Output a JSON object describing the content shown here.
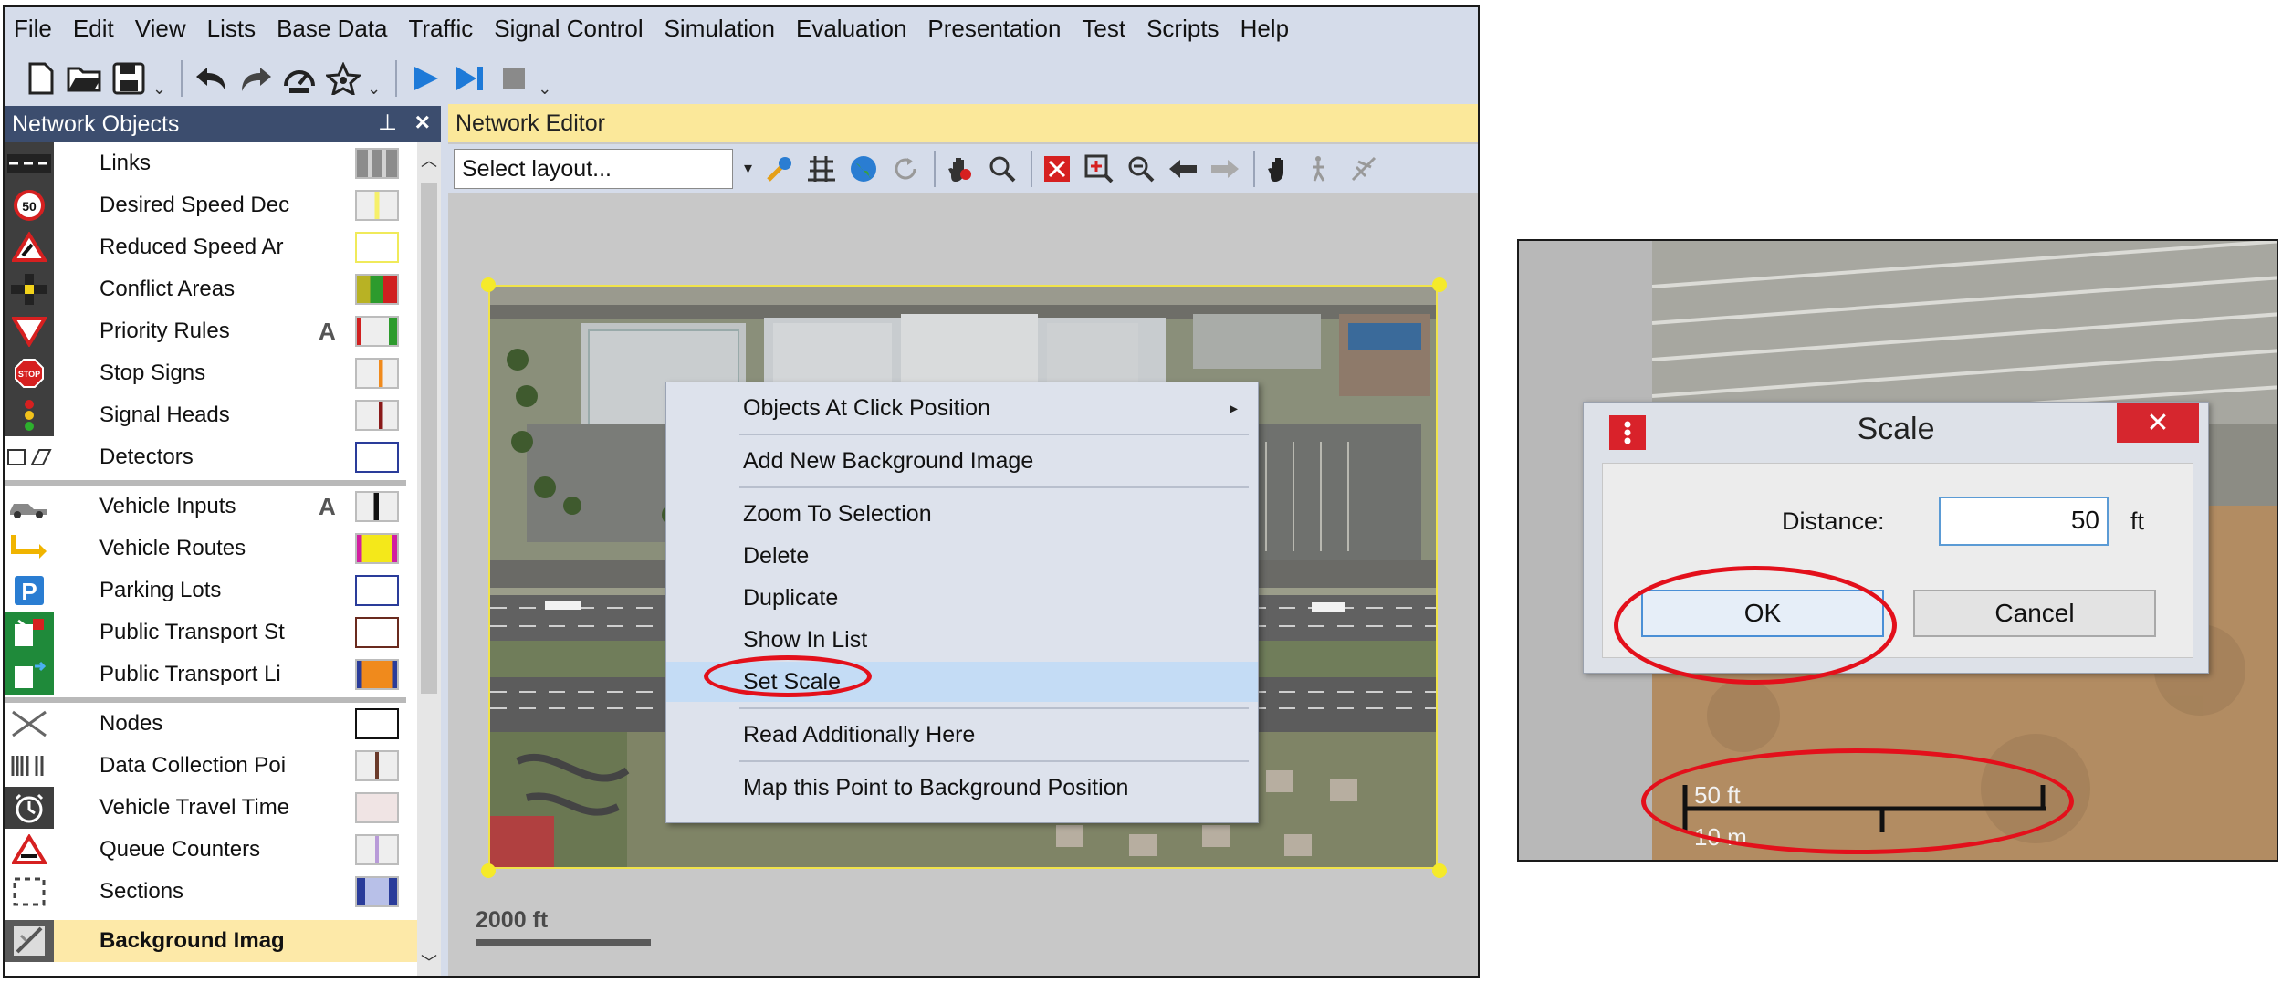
{
  "menubar": {
    "items": [
      "File",
      "Edit",
      "View",
      "Lists",
      "Base Data",
      "Traffic",
      "Signal Control",
      "Simulation",
      "Evaluation",
      "Presentation",
      "Test",
      "Scripts",
      "Help"
    ]
  },
  "toolbar": {
    "icons": [
      "new-file-icon",
      "open-folder-icon",
      "save-icon",
      "undo-icon",
      "redo-icon",
      "speedometer-icon",
      "star-icon",
      "play-icon",
      "step-icon",
      "stop-icon"
    ]
  },
  "network_objects": {
    "title": "Network Objects",
    "items": [
      {
        "label": "Links",
        "icon": "links-icon",
        "a": "",
        "swatch": "gray-stripes"
      },
      {
        "label": "Desired Speed Dec",
        "icon": "speed-50-icon",
        "a": "",
        "swatch": "yellow-line"
      },
      {
        "label": "Reduced Speed Ar",
        "icon": "reduced-speed-icon",
        "a": "",
        "swatch": "yellow-border"
      },
      {
        "label": "Conflict Areas",
        "icon": "conflict-areas-icon",
        "a": "",
        "swatch": "yellow-green-red"
      },
      {
        "label": "Priority Rules",
        "icon": "priority-rules-icon",
        "a": "A",
        "swatch": "red-green-bars"
      },
      {
        "label": "Stop Signs",
        "icon": "stop-sign-icon",
        "a": "",
        "swatch": "orange-line"
      },
      {
        "label": "Signal Heads",
        "icon": "signal-heads-icon",
        "a": "",
        "swatch": "dark-red-line"
      },
      {
        "label": "Detectors",
        "icon": "detectors-icon",
        "a": "",
        "swatch": "blue-border"
      },
      {
        "label": "Vehicle Inputs",
        "icon": "vehicle-inputs-icon",
        "a": "A",
        "swatch": "black-line"
      },
      {
        "label": "Vehicle Routes",
        "icon": "vehicle-routes-icon",
        "a": "",
        "swatch": "yellow-magenta"
      },
      {
        "label": "Parking Lots",
        "icon": "parking-lots-icon",
        "a": "",
        "swatch": "blue-border"
      },
      {
        "label": "Public Transport St",
        "icon": "pt-stops-icon",
        "a": "",
        "swatch": "brown-border"
      },
      {
        "label": "Public Transport Li",
        "icon": "pt-lines-icon",
        "a": "",
        "swatch": "orange-blue"
      },
      {
        "label": "Nodes",
        "icon": "nodes-icon",
        "a": "",
        "swatch": "black-border"
      },
      {
        "label": "Data Collection Poi",
        "icon": "data-collection-icon",
        "a": "",
        "swatch": "brown-line"
      },
      {
        "label": "Vehicle Travel Time",
        "icon": "travel-time-icon",
        "a": "",
        "swatch": "light-pink"
      },
      {
        "label": "Queue Counters",
        "icon": "queue-counters-icon",
        "a": "",
        "swatch": "lilac-line"
      },
      {
        "label": "Sections",
        "icon": "sections-icon",
        "a": "",
        "swatch": "blue-gradient"
      },
      {
        "label": "Background Imag",
        "icon": "background-image-icon",
        "a": "",
        "swatch": "",
        "selected": true
      }
    ]
  },
  "editor": {
    "title": "Network Editor",
    "layout_select": "Select layout...",
    "scale_bar_label": "2000 ft"
  },
  "context_menu": {
    "items": [
      "Objects At Click Position",
      "Add New Background Image",
      "Zoom To Selection",
      "Delete",
      "Duplicate",
      "Show In List",
      "Set Scale",
      "Read Additionally Here",
      "Map this Point to Background Position"
    ],
    "highlighted": "Set Scale"
  },
  "scale_dialog": {
    "title": "Scale",
    "close_label": "✕",
    "distance_label": "Distance:",
    "distance_value": "50",
    "unit": "ft",
    "ok_label": "OK",
    "cancel_label": "Cancel"
  },
  "inset": {
    "scale_ft": "50 ft",
    "scale_m": "10 m"
  },
  "colors": {
    "highlight_red": "#e3101b",
    "panel_header": "#3c4d6e",
    "editor_header": "#fbe89a",
    "selection_blue": "#c4dcf5"
  }
}
